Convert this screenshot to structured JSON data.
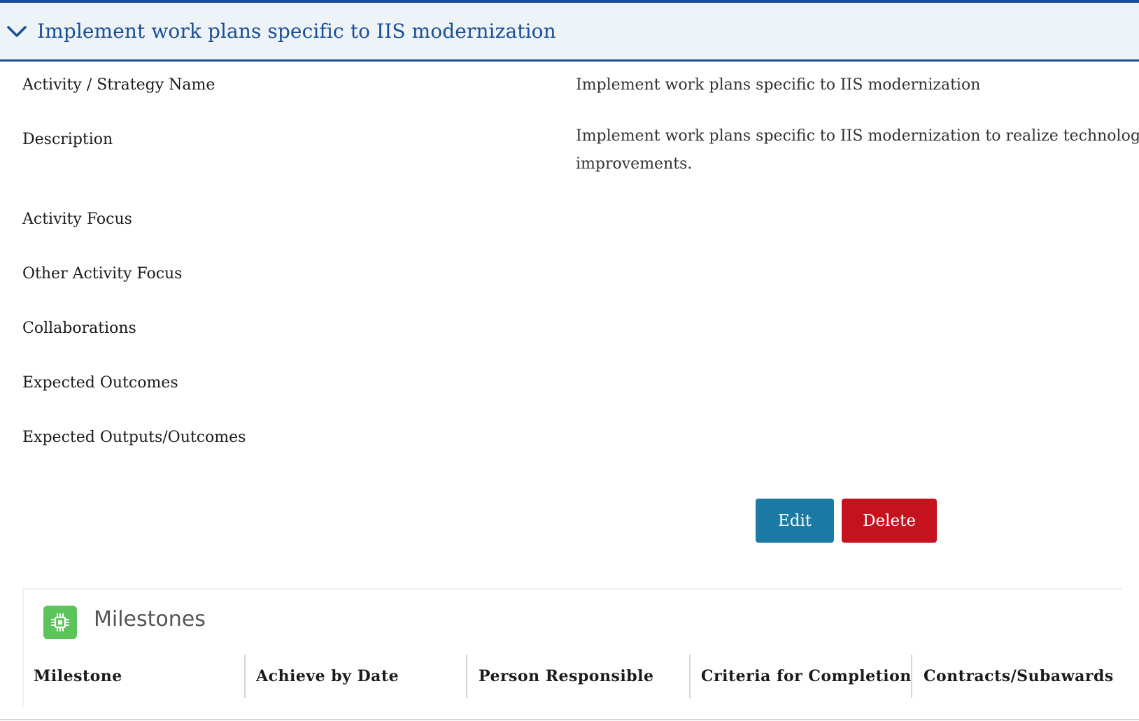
{
  "accordion": {
    "title": "Implement work plans specific to IIS modernization",
    "expanded": true,
    "accent_color": "#1a4f95"
  },
  "fields": [
    {
      "label": "Activity / Strategy Name",
      "value": "Implement work plans specific to IIS modernization"
    },
    {
      "label": "Description",
      "value_line1": "Implement work plans specific to IIS modernization to realize technology, d",
      "value_line2": "improvements."
    },
    {
      "label": "Activity Focus",
      "value": ""
    },
    {
      "label": "Other Activity Focus",
      "value": ""
    },
    {
      "label": "Collaborations",
      "value": ""
    },
    {
      "label": "Expected Outcomes",
      "value": ""
    },
    {
      "label": "Expected Outputs/Outcomes",
      "value": ""
    }
  ],
  "actions": {
    "edit_label": "Edit",
    "delete_label": "Delete",
    "edit_color": "#1b7aa3",
    "delete_color": "#c4121e"
  },
  "milestones": {
    "title": "Milestones",
    "icon": "chip-icon",
    "icon_color": "#5cc45a",
    "columns": [
      "Milestone",
      "Achieve by Date",
      "Person Responsible",
      "Criteria for Completion",
      "Contracts/Subawards"
    ]
  }
}
